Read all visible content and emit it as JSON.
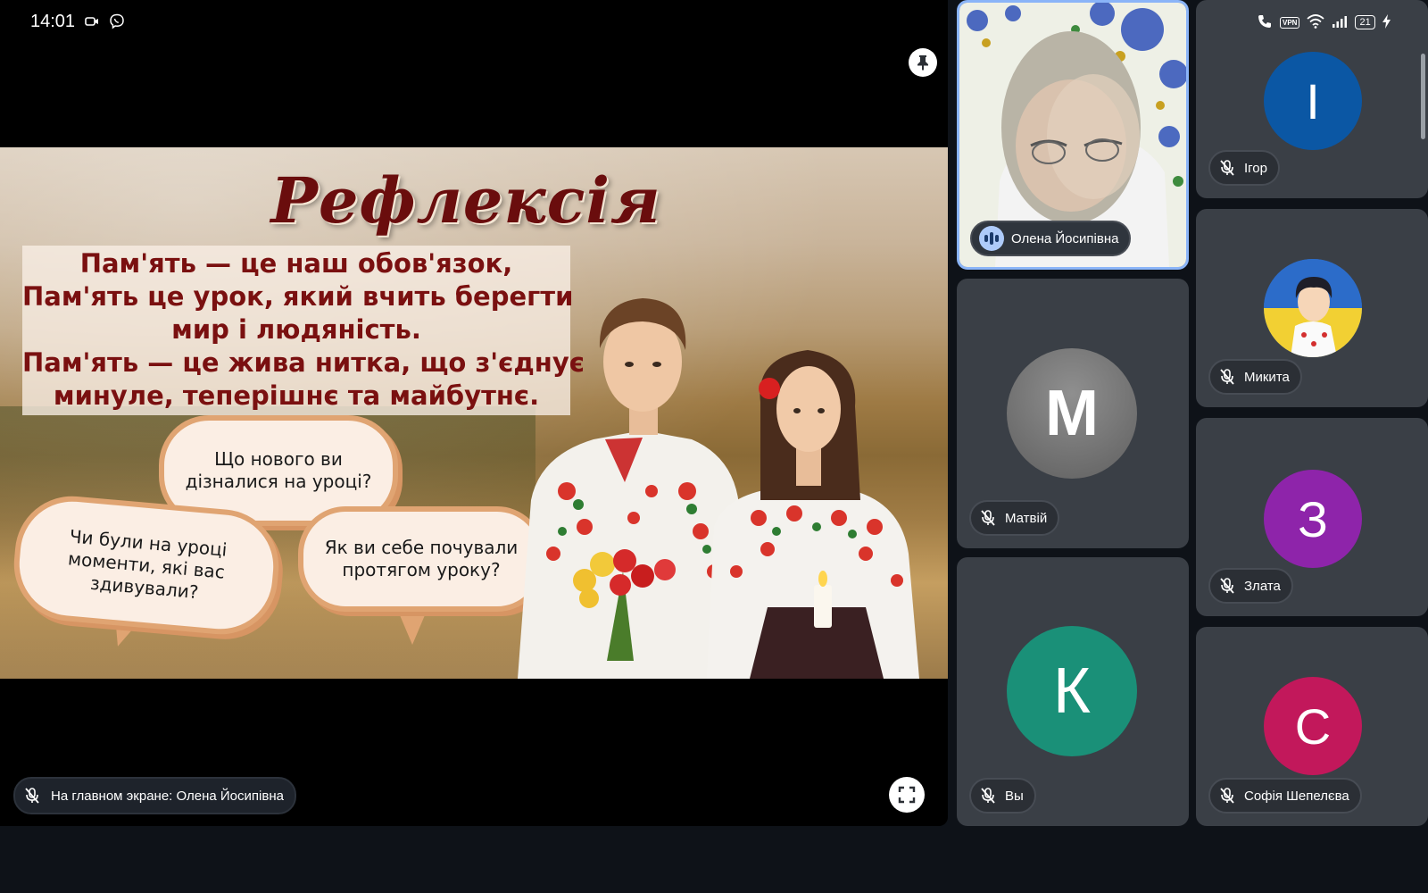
{
  "status_bar": {
    "time": "14:01",
    "battery": "21",
    "vpn": "VPN"
  },
  "slide": {
    "title": "Рефлексія",
    "quote_lines": [
      "Пам'ять — це наш обов'язок,",
      "Пам'ять це урок, який вчить берегти",
      "мир і людяність.",
      "Пам'ять — це жива нитка, що з'єднує",
      "минуле, теперішнє та майбутнє."
    ],
    "bubbles": [
      {
        "text_lines": [
          "Що нового ви",
          "дізналися на уроці?"
        ]
      },
      {
        "text_lines": [
          "Чи були на уроці",
          "моменти, які вас",
          "здивували?"
        ]
      },
      {
        "text_lines": [
          "Як ви себе почували",
          "протягом уроку?"
        ]
      }
    ]
  },
  "stage_label": "На главном экране: Олена Йосипівна",
  "participants": [
    {
      "name": "Олена Йосипівна",
      "speaking": true
    },
    {
      "name": "Ігор",
      "initial": "І",
      "color": "#0b57a4"
    },
    {
      "name": "Микита"
    },
    {
      "name": "Матвій",
      "initial": "М",
      "color": "#757575"
    },
    {
      "name": "Злата",
      "initial": "З",
      "color": "#8e24aa"
    },
    {
      "name": "Вы",
      "initial": "К",
      "color": "#1a9078"
    },
    {
      "name": "Софія Шепелєва",
      "initial": "С",
      "color": "#c2185b"
    }
  ]
}
